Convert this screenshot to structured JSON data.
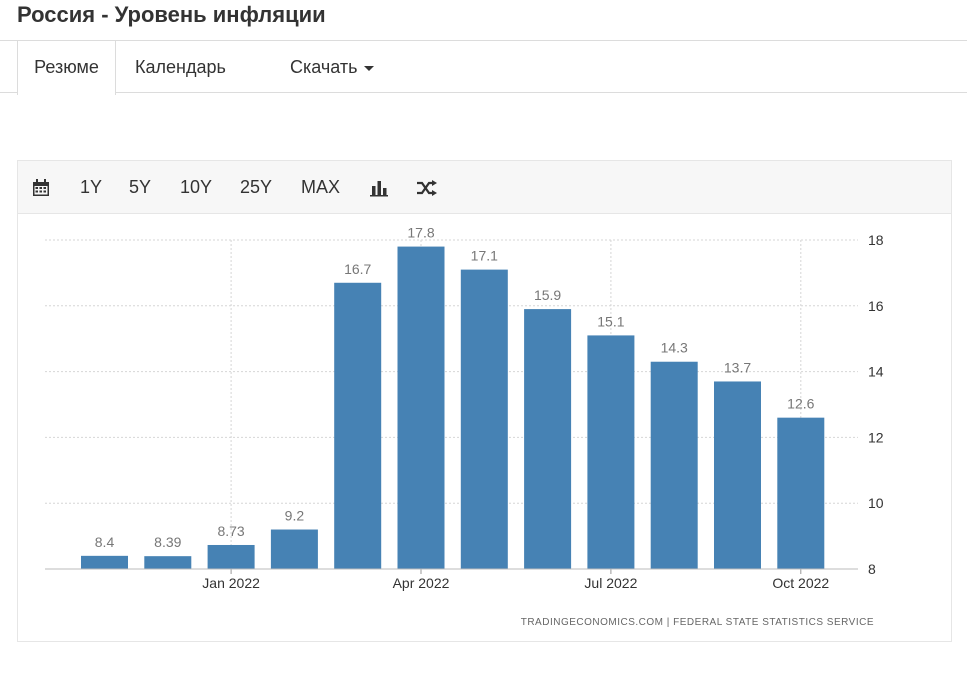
{
  "page": {
    "title": "Россия - Уровень инфляции"
  },
  "tabs": [
    {
      "label": "Резюме",
      "active": true
    },
    {
      "label": "Календарь"
    },
    {
      "label": "Скачать"
    }
  ],
  "toolbar": {
    "calendar_icon": "calendar-icon",
    "ranges": [
      "1Y",
      "5Y",
      "10Y",
      "25Y",
      "MAX"
    ],
    "chart_type_icon": "bar-chart-icon",
    "compare_icon": "shuffle-icon"
  },
  "colors": {
    "bar": "#4682b4",
    "grid": "#d6d6d6",
    "label": "#777777",
    "axis_text": "#333333"
  },
  "chart_data": {
    "type": "bar",
    "categories": [
      "Nov 2021",
      "Dec 2021",
      "Jan 2022",
      "Feb 2022",
      "Mar 2022",
      "Apr 2022",
      "May 2022",
      "Jun 2022",
      "Jul 2022",
      "Aug 2022",
      "Sep 2022",
      "Oct 2022"
    ],
    "values": [
      8.4,
      8.39,
      8.73,
      9.2,
      16.7,
      17.8,
      17.1,
      15.9,
      15.1,
      14.3,
      13.7,
      12.6
    ],
    "data_labels": [
      "8.4",
      "8.39",
      "8.73",
      "9.2",
      "16.7",
      "17.8",
      "17.1",
      "15.9",
      "15.1",
      "14.3",
      "13.7",
      "12.6"
    ],
    "x_tick_labels": [
      {
        "category": "Jan 2022",
        "label": "Jan 2022"
      },
      {
        "category": "Apr 2022",
        "label": "Apr 2022"
      },
      {
        "category": "Jul 2022",
        "label": "Jul 2022"
      },
      {
        "category": "Oct 2022",
        "label": "Oct 2022"
      }
    ],
    "y_ticks": [
      "8",
      "10",
      "12",
      "14",
      "16",
      "18"
    ],
    "ylim": [
      8,
      18
    ],
    "y_axis_side": "right",
    "grid": true,
    "source": "TRADINGECONOMICS.COM  |  FEDERAL STATE STATISTICS SERVICE"
  }
}
